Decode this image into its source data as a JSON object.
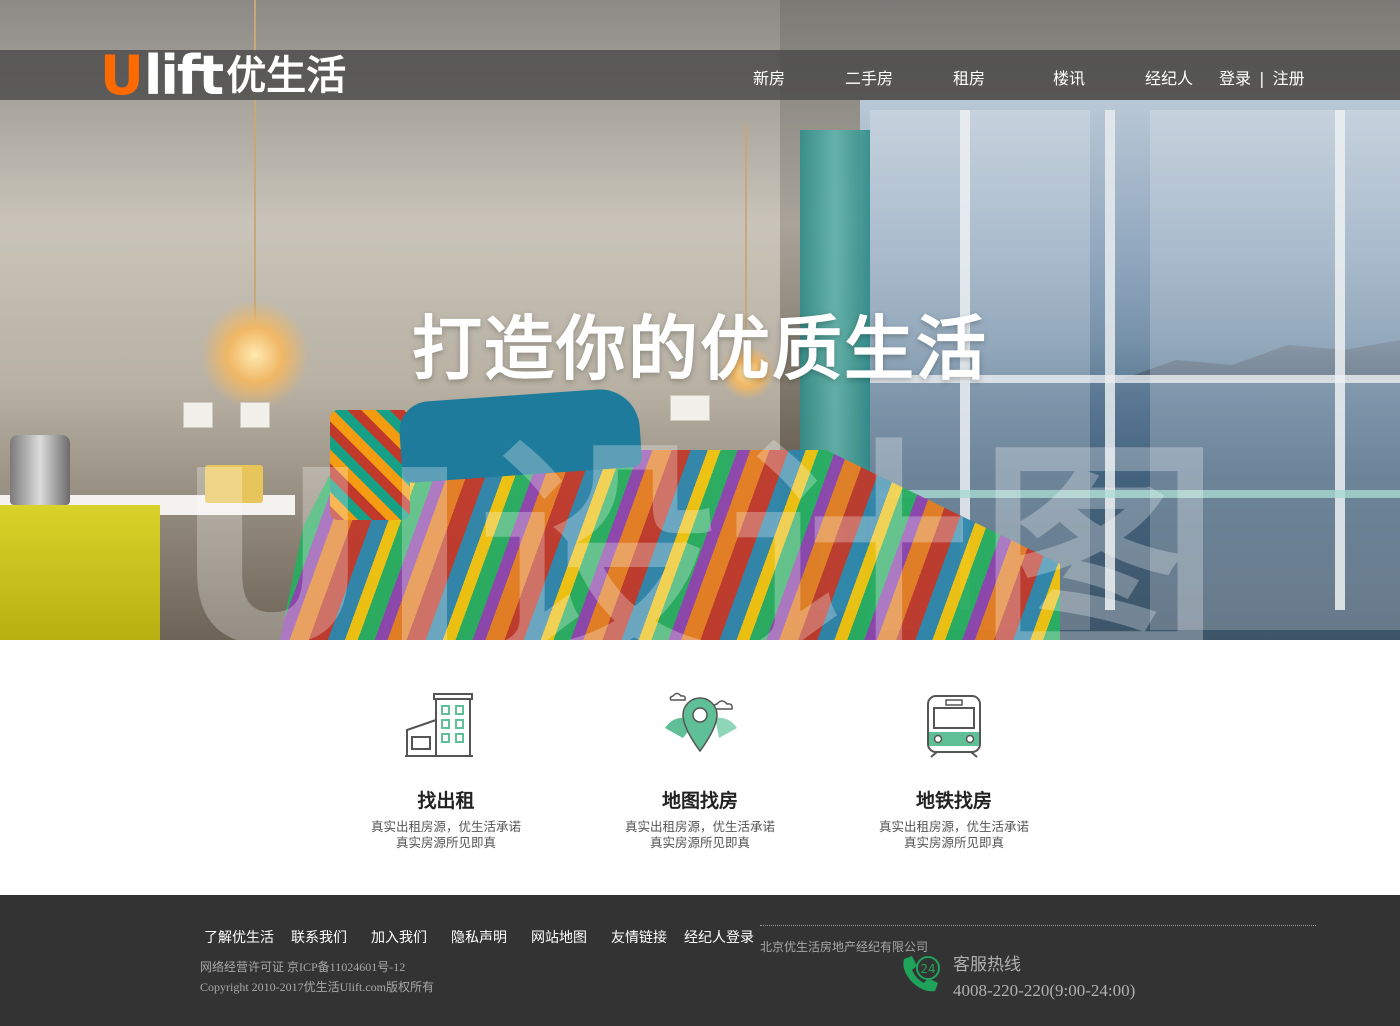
{
  "brand": {
    "logo_u": "U",
    "logo_lift": "lift",
    "logo_cn": "优生活"
  },
  "nav": {
    "items": [
      "新房",
      "二手房",
      "租房",
      "楼讯",
      "经纪人"
    ],
    "login": "登录",
    "separator": "|",
    "register": "注册"
  },
  "hero": {
    "headline": "打造你的优质生活",
    "watermark": "UI设计图"
  },
  "features": [
    {
      "icon": "building-icon",
      "title": "找出租",
      "desc_line1": "真实出租房源，优生活承诺",
      "desc_line2": "真实房源所见即真"
    },
    {
      "icon": "map-pin-icon",
      "title": "地图找房",
      "desc_line1": "真实出租房源，优生活承诺",
      "desc_line2": "真实房源所见即真"
    },
    {
      "icon": "subway-icon",
      "title": "地铁找房",
      "desc_line1": "真实出租房源，优生活承诺",
      "desc_line2": "真实房源所见即真"
    }
  ],
  "footer": {
    "links": [
      "了解优生活",
      "联系我们",
      "加入我们",
      "隐私声明",
      "网站地图",
      "友情链接",
      "经纪人登录"
    ],
    "company": "北京优生活房地产经纪有限公司",
    "license": "网络经营许可证 京ICP备11024601号-12",
    "copyright": "Copyright 2010-2017优生活Ulift.com版权所有",
    "hotline_label": "客服热线",
    "hotline_number": "4008-220-220(9:00-24:00)",
    "hotline_badge": "24"
  },
  "colors": {
    "accent": "#ff6a00",
    "icon_green": "#5fbf96",
    "footer_bg": "#333333"
  }
}
